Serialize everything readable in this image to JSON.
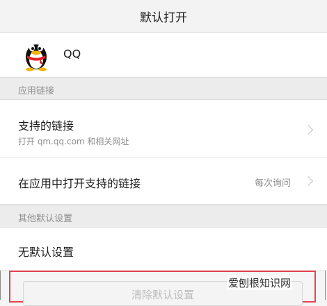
{
  "header": {
    "title": "默认打开"
  },
  "app": {
    "name": "QQ",
    "icon": "qq-penguin-icon"
  },
  "section_app_links": {
    "title": "应用链接"
  },
  "supported_links": {
    "label": "支持的链接",
    "subtitle": "打开 qm.qq.com 和相关网址"
  },
  "open_supported_links": {
    "label": "在应用中打开支持的链接",
    "value": "每次询问"
  },
  "section_other_defaults": {
    "title": "其他默认设置"
  },
  "no_defaults": {
    "label": "无默认设置"
  },
  "clear_defaults": {
    "label": "清除默认设置"
  },
  "watermark": {
    "text": "爱刨根知识网"
  },
  "colors": {
    "highlight": "#e8424f",
    "background": "#f5f5f5",
    "section_header": "#ececec"
  }
}
